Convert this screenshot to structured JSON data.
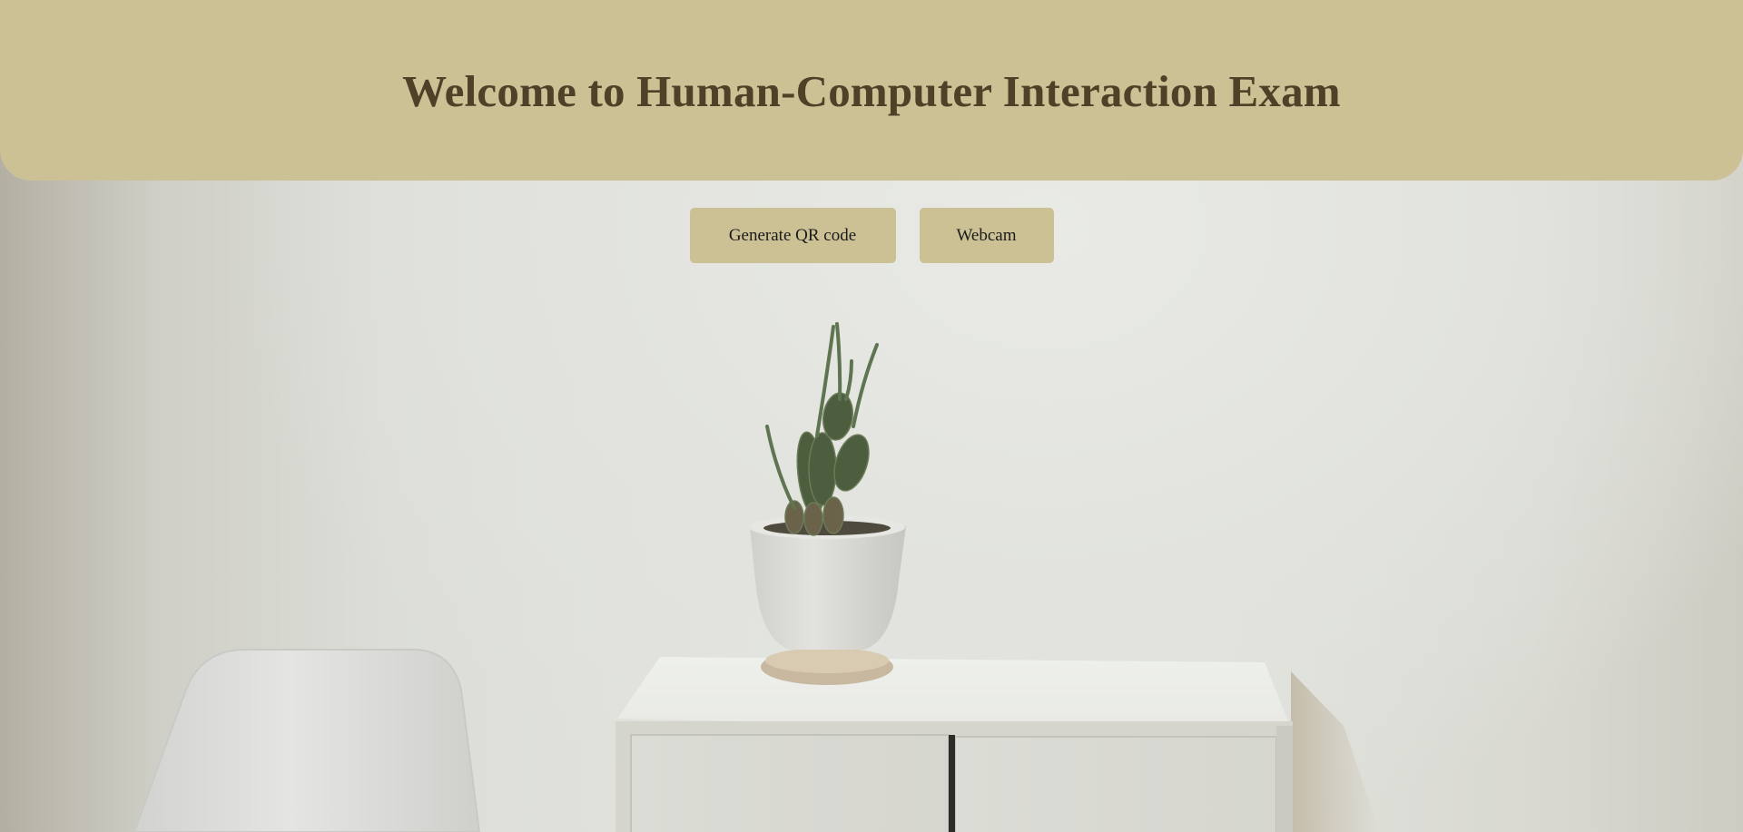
{
  "header": {
    "title": "Welcome to Human-Computer Interaction Exam"
  },
  "actions": {
    "generate_qr_label": "Generate QR code",
    "webcam_label": "Webcam"
  },
  "colors": {
    "header_bg": "#ccc195",
    "title_text": "#4d4127",
    "button_bg": "#ccc195",
    "button_text": "#1b1b1b"
  },
  "background": {
    "description_icon": "room-photo-image"
  }
}
